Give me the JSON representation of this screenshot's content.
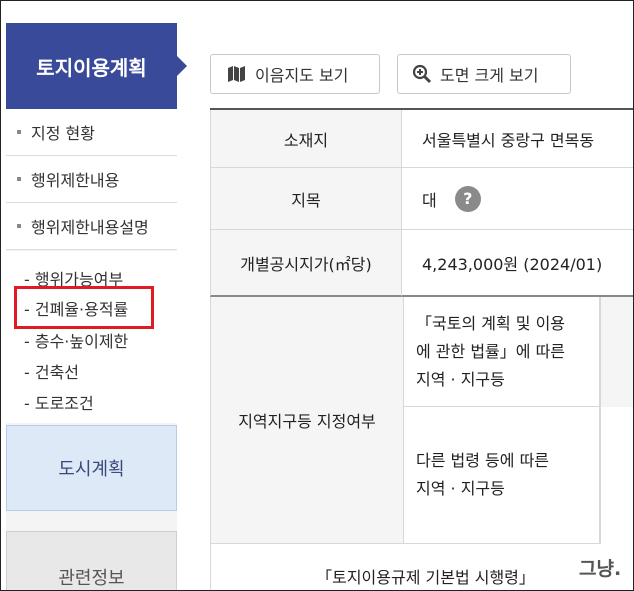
{
  "sidebar": {
    "header": "토지이용계획",
    "items": [
      "지정 현황",
      "행위제한내용",
      "행위제한내용설명"
    ],
    "sub_items": [
      "- 행위가능여부",
      "- 건폐율·용적률",
      "- 층수·높이제한",
      "- 건축선",
      "- 도로조건"
    ],
    "city_plan": "도시계획",
    "related": "관련정보"
  },
  "toolbar": {
    "map_button": "이음지도 보기",
    "zoom_button": "도면 크게 보기"
  },
  "table": {
    "location_label": "소재지",
    "location_value": "서울특별시 중랑구 면목동",
    "land_category_label": "지목",
    "land_category_value": "대",
    "help_symbol": "?",
    "price_label": "개별공시지가(㎡당)",
    "price_value": "4,243,000원 (2024/01)",
    "zone_label": "지역지구등 지정여부",
    "zone_sub1": [
      "「국토의 계획 및 이용",
      "에 관한 법률」에 따른",
      "지역 · 지구등"
    ],
    "zone_sub2": [
      "다른 법령 등에 따른",
      "지역 · 지구등"
    ],
    "bottom_line1": "「토지이용규제 기본법 시행령」"
  },
  "watermark": "그냥."
}
